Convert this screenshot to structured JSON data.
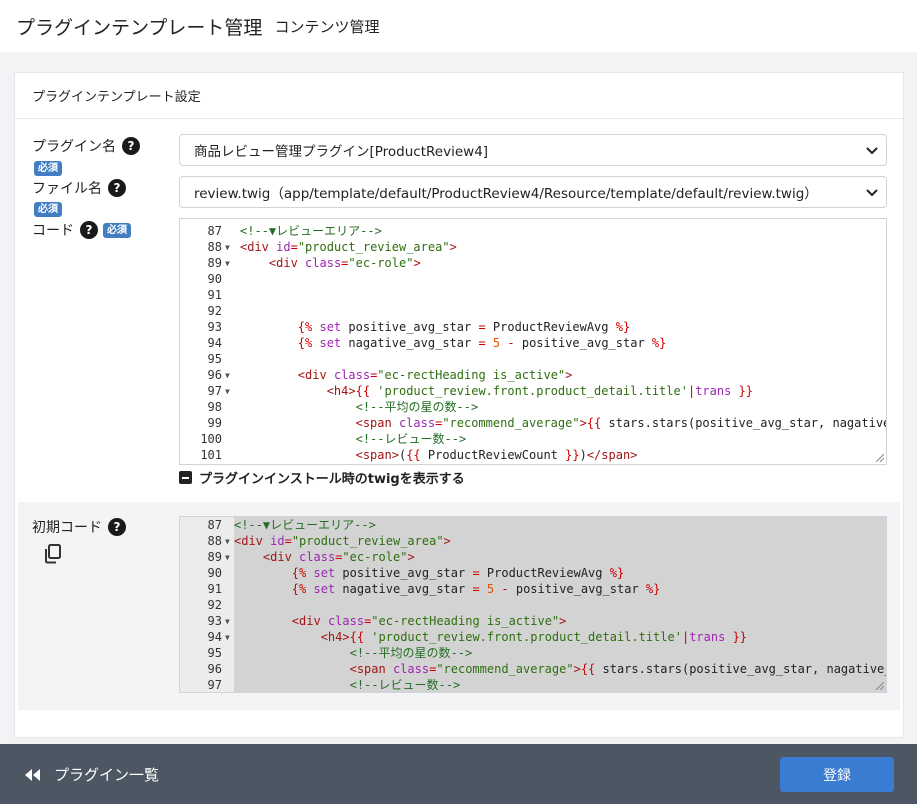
{
  "header": {
    "title": "プラグインテンプレート管理",
    "subtitle": "コンテンツ管理"
  },
  "card": {
    "title": "プラグインテンプレート設定"
  },
  "form": {
    "plugin_label": "プラグイン名",
    "file_label": "ファイル名",
    "code_label": "コード",
    "required_badge": "必須",
    "plugin_value": "商品レビュー管理プラグイン[ProductReview4]",
    "file_value": "review.twig（app/template/default/ProductReview4/Resource/template/default/review.twig）",
    "toggle_label": "プラグインインストール時のtwigを表示する",
    "initial_label": "初期コード"
  },
  "footer": {
    "back_label": "プラグイン一覧",
    "submit_label": "登録"
  },
  "colors": {
    "header_bg": "#ffffff",
    "footer_bg": "#4d5764",
    "primary": "#3a7cd1",
    "badge": "#437ec4"
  },
  "icons": {
    "help": "question-circle-icon",
    "select": "chevron-down-icon",
    "copy": "copy-icon",
    "back": "double-chevron-left-icon",
    "toggle": "minus-square-icon"
  },
  "code_editor": {
    "lines": [
      {
        "n": "87",
        "fold": false,
        "t": "<!--▼レビューエリア-->"
      },
      {
        "n": "88",
        "fold": true,
        "t": "<div id=\"product_review_area\">"
      },
      {
        "n": "89",
        "fold": true,
        "t": "    <div class=\"ec-role\">"
      },
      {
        "n": "90",
        "fold": false,
        "t": ""
      },
      {
        "n": "91",
        "fold": false,
        "t": ""
      },
      {
        "n": "92",
        "fold": false,
        "t": ""
      },
      {
        "n": "93",
        "fold": false,
        "t": "        {% set positive_avg_star = ProductReviewAvg %}"
      },
      {
        "n": "94",
        "fold": false,
        "t": "        {% set nagative_avg_star = 5 - positive_avg_star %}"
      },
      {
        "n": "95",
        "fold": false,
        "t": ""
      },
      {
        "n": "96",
        "fold": true,
        "t": "        <div class=\"ec-rectHeading is_active\">"
      },
      {
        "n": "97",
        "fold": true,
        "t": "            <h4>{{ 'product_review.front.product_detail.title'|trans }}"
      },
      {
        "n": "98",
        "fold": false,
        "t": "                <!--平均の星の数-->"
      },
      {
        "n": "99",
        "fold": false,
        "t": "                <span class=\"recommend_average\">{{ stars.stars(positive_avg_star, nagative"
      },
      {
        "n": "100",
        "fold": false,
        "t": "                <!--レビュー数-->"
      },
      {
        "n": "101",
        "fold": false,
        "t": "                <span>({{ ProductReviewCount }})</span>"
      }
    ]
  },
  "initial_editor": {
    "lines": [
      {
        "n": "87",
        "fold": false,
        "t": "<!--▼レビューエリア-->"
      },
      {
        "n": "88",
        "fold": true,
        "t": "<div id=\"product_review_area\">"
      },
      {
        "n": "89",
        "fold": true,
        "t": "    <div class=\"ec-role\">"
      },
      {
        "n": "90",
        "fold": false,
        "t": "        {% set positive_avg_star = ProductReviewAvg %}"
      },
      {
        "n": "91",
        "fold": false,
        "t": "        {% set nagative_avg_star = 5 - positive_avg_star %}"
      },
      {
        "n": "92",
        "fold": false,
        "t": ""
      },
      {
        "n": "93",
        "fold": true,
        "t": "        <div class=\"ec-rectHeading is_active\">"
      },
      {
        "n": "94",
        "fold": true,
        "t": "            <h4>{{ 'product_review.front.product_detail.title'|trans }}"
      },
      {
        "n": "95",
        "fold": false,
        "t": "                <!--平均の星の数-->"
      },
      {
        "n": "96",
        "fold": false,
        "t": "                <span class=\"recommend_average\">{{ stars.stars(positive_avg_star, nagative_"
      },
      {
        "n": "97",
        "fold": false,
        "t": "                <!--レビュー数-->"
      }
    ]
  }
}
